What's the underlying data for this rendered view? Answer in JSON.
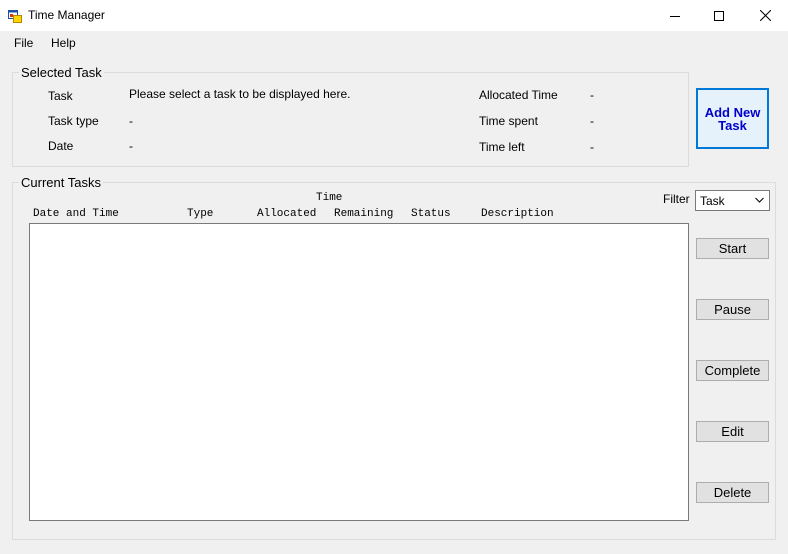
{
  "window": {
    "title": "Time Manager",
    "icon": "app-window-icon",
    "controls": [
      "minimize-icon",
      "maximize-icon",
      "close-icon"
    ]
  },
  "menu": {
    "file": "File",
    "help": "Help"
  },
  "selected_task": {
    "title": "Selected Task",
    "task_label": "Task",
    "task_value": "Please select a task to be displayed here.",
    "type_label": "Task type",
    "type_value": "-",
    "date_label": "Date",
    "date_value": "-",
    "allocated_label": "Allocated Time",
    "allocated_value": "-",
    "spent_label": "Time spent",
    "spent_value": "-",
    "left_label": "Time left",
    "left_value": "-"
  },
  "add_task_button": "Add New Task",
  "current_tasks": {
    "title": "Current Tasks",
    "filter_label": "Filter",
    "filter_value": "Task",
    "header_time_group": "Time",
    "columns": [
      "Date and Time",
      "Type",
      "Allocated",
      "Remaining",
      "Status",
      "Description"
    ]
  },
  "actions": {
    "start": "Start",
    "pause": "Pause",
    "complete": "Complete",
    "edit": "Edit",
    "delete": "Delete"
  },
  "colors": {
    "window_bg": "#f0f0f0",
    "accent": "#0078d7",
    "primary_text": "#0000cc"
  }
}
